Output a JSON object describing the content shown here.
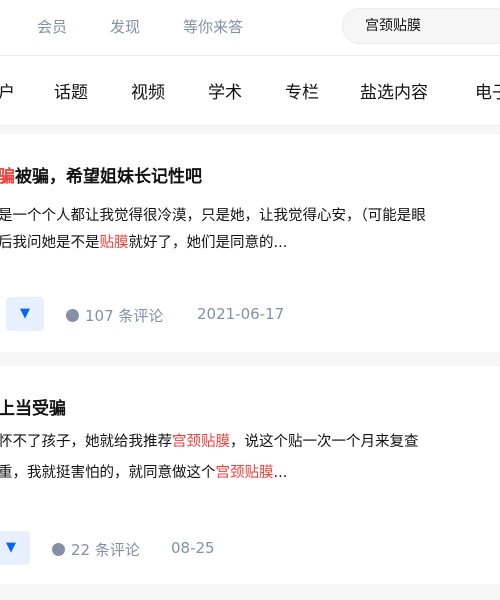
{
  "top_nav": {
    "items": [
      "会员",
      "发现",
      "等你来答"
    ]
  },
  "search": {
    "query": "宫颈贴膜"
  },
  "tabs": [
    "户",
    "话题",
    "视频",
    "学术",
    "专栏",
    "盐选内容",
    "电子"
  ],
  "results": [
    {
      "title_accent": "骗",
      "title_rest": "被骗，希望姐妹长记性吧",
      "line1": "是一个个人都让我觉得很冷漠，只是她，让我觉得心安，（可能是眼",
      "line2_before": "后我问她是不是",
      "line2_hl": "贴膜",
      "line2_after": "就好了，她们是同意的...",
      "vote_icon": "triangle-down",
      "comments": "107 条评论",
      "date": "2021-06-17"
    },
    {
      "title": "上当受骗",
      "line1_before": "怀不了孩子，她就给我推荐",
      "line1_hl": "宫颈贴膜",
      "line1_after": "，说这个贴一次一个月来复查",
      "line2_before": "重，我就挺害怕的，就同意做这个",
      "line2_hl": "宫颈贴膜",
      "line2_after": "...",
      "vote_icon": "triangle-down",
      "comments": "22 条评论",
      "date": "08-25"
    }
  ],
  "colors": {
    "highlight": "#f1403c",
    "vote_bg": "#e8f0fd",
    "vote_fg": "#0066ff",
    "meta": "#8590a6"
  }
}
